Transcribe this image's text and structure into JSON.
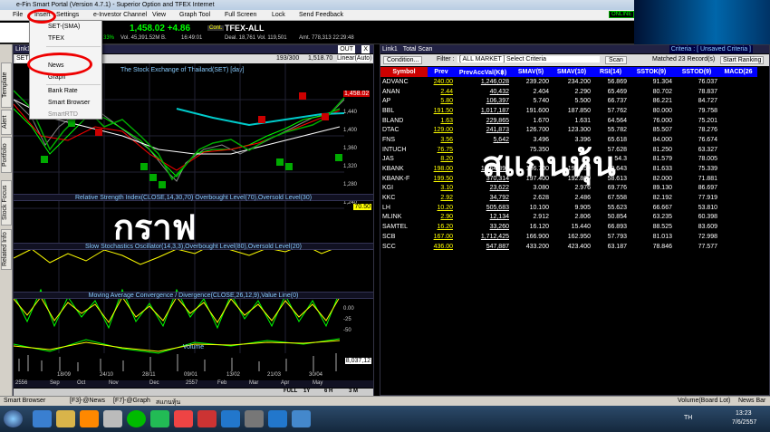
{
  "window": {
    "title": "e-Fin Smart Portal (Version 4.7.1) - Superior Option and TFEX Internet"
  },
  "menu": {
    "items": [
      "File",
      "Insert",
      "Settings",
      "e-Investor Channel",
      "View",
      "Graph Tool",
      "Full Screen",
      "Lock",
      "Send Feedback"
    ]
  },
  "toolbar": {
    "online": "ONLINE"
  },
  "ticker": {
    "set_value": "1,458.02 +4.86",
    "set_pct": "33%",
    "vol_label": "Vol. 45,391.52M B.",
    "time1": "16:49:01",
    "dropdown_label": "Cont.",
    "tfex_label": "TFEX-ALL",
    "deal_label": "Deal. 18,761 Vol. 119,501",
    "amt_label": "Amt. 778,313 22:29:48"
  },
  "dropdown": {
    "items": [
      "SET-(SMA)",
      "TFEX",
      "",
      "News",
      "Graph",
      "Bank Rate",
      "Smart Browser",
      "SmartRTD"
    ]
  },
  "chart": {
    "tab": "Link1",
    "symbol_input": "SET",
    "title": "The Stock Exchange of Thailand(SET) [day]",
    "out_label": "OUT",
    "close_label": "X",
    "range_label": "193/300",
    "price_label": "1,518.70",
    "scale_label": "Linear(Auto)",
    "last_price": "1,458.02",
    "price_ticks": [
      "1,440",
      "1,400",
      "1,360",
      "1,320",
      "1,280",
      "1,240"
    ],
    "rsi_label": "Relative Strength Index(CLOSE,14,30,70) Overbought Level(70),Oversold Level(30)",
    "rsi_value": "70.50",
    "stoch_label": "Slow Stochastics Oscillator(14,3,3),Overbought Level(80),Oversold Level(20)",
    "macd_label": "Moving Average Convergence / Divergence(CLOSE,26,12,9),Value Line(0)",
    "macd_ticks": [
      "0.00",
      "-25",
      "-50"
    ],
    "volume_label": "Volume",
    "volume_value": "8,037,12",
    "dates": [
      "18/09",
      "24/10",
      "28/11",
      "09/01",
      "13/02",
      "21/03",
      "30/04"
    ],
    "years": [
      "2556",
      "Sep",
      "Oct",
      "Nov",
      "Dec",
      "2557",
      "Feb",
      "Mar",
      "Apr",
      "May"
    ],
    "period_buttons": [
      "FULL",
      "1Y",
      "6 H",
      "3 M"
    ],
    "overlay_text": "กราฟ"
  },
  "scan": {
    "tab": "Link1",
    "title": "Total Scan",
    "criteria_label": "Criteria : [ Unsaved Criteria ]",
    "condition_btn": "Condition...",
    "filter_label": "Filter :",
    "filter_value": "[ ALL MARKET ]",
    "criteria_select": "Select Criteria",
    "scan_btn": "Scan",
    "matched": "Matched 23 Record(s)",
    "start_ranking": "Start Ranking",
    "columns": [
      "Symbol",
      "Prev",
      "PrevAccVal(K฿)",
      "SMAV(5)",
      "SMAV(10)",
      "RSI(14)",
      "SSTOK(9)",
      "SSTOD(9)",
      "MACD(26"
    ],
    "rows": [
      [
        "ADVANC",
        "240.00",
        "1,246,028",
        "239.200",
        "234.200",
        "56.869",
        "91.304",
        "76.037"
      ],
      [
        "ANAN",
        "2.44",
        "40,432",
        "2.404",
        "2.290",
        "65.469",
        "80.702",
        "78.837"
      ],
      [
        "AP",
        "5.80",
        "106,397",
        "5.740",
        "5.500",
        "66.737",
        "86.221",
        "84.727"
      ],
      [
        "BBL",
        "191.50",
        "1,017,187",
        "191.600",
        "187.850",
        "57.762",
        "80.000",
        "79.758"
      ],
      [
        "BLAND",
        "1.63",
        "229,865",
        "1.670",
        "1.631",
        "64.564",
        "76.000",
        "75.201"
      ],
      [
        "DTAC",
        "129.00",
        "241,873",
        "126.700",
        "123.300",
        "55.782",
        "85.507",
        "78.276"
      ],
      [
        "FNS",
        "3.56",
        "5,642",
        "3.496",
        "3.396",
        "65.618",
        "84.000",
        "76.674"
      ],
      [
        "INTUCH",
        "76.75",
        "",
        "75.350",
        "",
        "57.628",
        "81.250",
        "63.327"
      ],
      [
        "JAS",
        "8.20",
        "",
        "",
        "",
        "54.3",
        "81.579",
        "78.005"
      ],
      [
        "KBANK",
        "198.00",
        "1,264,895",
        "196.700",
        "192.650",
        "60.643",
        "81.633",
        "75.339"
      ],
      [
        "KBANK-F",
        "199.50",
        "370,314",
        "197.400",
        "192.800",
        "58.613",
        "82.000",
        "71.881"
      ],
      [
        "KGI",
        "3.10",
        "23,622",
        "3.080",
        "2.976",
        "69.776",
        "89.130",
        "86.697"
      ],
      [
        "KKC",
        "2.92",
        "34,792",
        "2.628",
        "2.486",
        "67.558",
        "82.192",
        "77.919"
      ],
      [
        "LH",
        "10.20",
        "505,683",
        "10.100",
        "9.905",
        "55.623",
        "66.667",
        "53.810"
      ],
      [
        "MLINK",
        "2.90",
        "12,134",
        "2.912",
        "2.806",
        "50.854",
        "63.235",
        "60.398"
      ],
      [
        "SAMTEL",
        "16.20",
        "33,260",
        "16.120",
        "15.440",
        "66.893",
        "88.525",
        "83.609"
      ],
      [
        "SCB",
        "167.00",
        "1,712,425",
        "166.900",
        "162.950",
        "57.793",
        "81.013",
        "72.998"
      ],
      [
        "SCC",
        "436.00",
        "547,887",
        "433.200",
        "423.400",
        "63.187",
        "78.846",
        "77.577"
      ]
    ],
    "overlay_text": "สแกนหุ้น"
  },
  "status": {
    "smart_browser": "Smart Browser",
    "news_tab": "[F3]-@News",
    "graph_tab": "[F7]-@Graph",
    "thai_tab": "สแกนหุ้น",
    "volume_board": "Volume(Board Lot)",
    "news_bar": "News Bar"
  },
  "taskbar": {
    "lang": "TH",
    "time": "13:23",
    "date": "7/6/2557"
  }
}
